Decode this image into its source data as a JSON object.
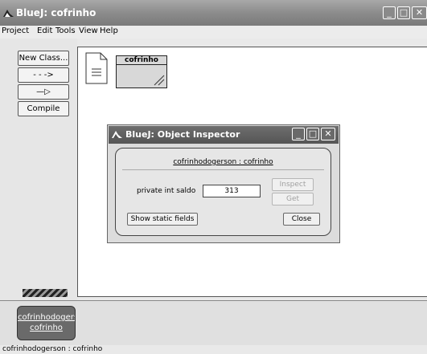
{
  "window": {
    "title": "BlueJ:  cofrinho",
    "icon": "bluej-logo-icon",
    "controls": [
      "minimize",
      "maximize",
      "close"
    ],
    "control_glyphs": {
      "minimize": "_",
      "maximize": "□",
      "close": "✕"
    }
  },
  "menubar": [
    "Project",
    "Edit",
    "Tools",
    "View",
    "Help"
  ],
  "toolbar": {
    "new_class": "New Class...",
    "uses_arrow": "- - ->",
    "inherit_arrow": "—▷",
    "compile": "Compile"
  },
  "diagram": {
    "class_name": "cofrinho"
  },
  "bench": {
    "object_line1": "cofrinhodogerson",
    "object_line2": "cofrinho"
  },
  "status": "cofrinhodogerson : cofrinho",
  "inspector": {
    "title": "BlueJ:  Object Inspector",
    "object_header": "cofrinhodogerson : cofrinho",
    "field_label": "private int saldo",
    "field_value": "313",
    "inspect_button": "Inspect",
    "get_button": "Get",
    "static_fields_button": "Show static fields",
    "close_button": "Close"
  },
  "colors": {
    "titlebar": "#8c8c8c",
    "bench_object": "#6a6a6a",
    "class_box": "#d8d8d8"
  }
}
